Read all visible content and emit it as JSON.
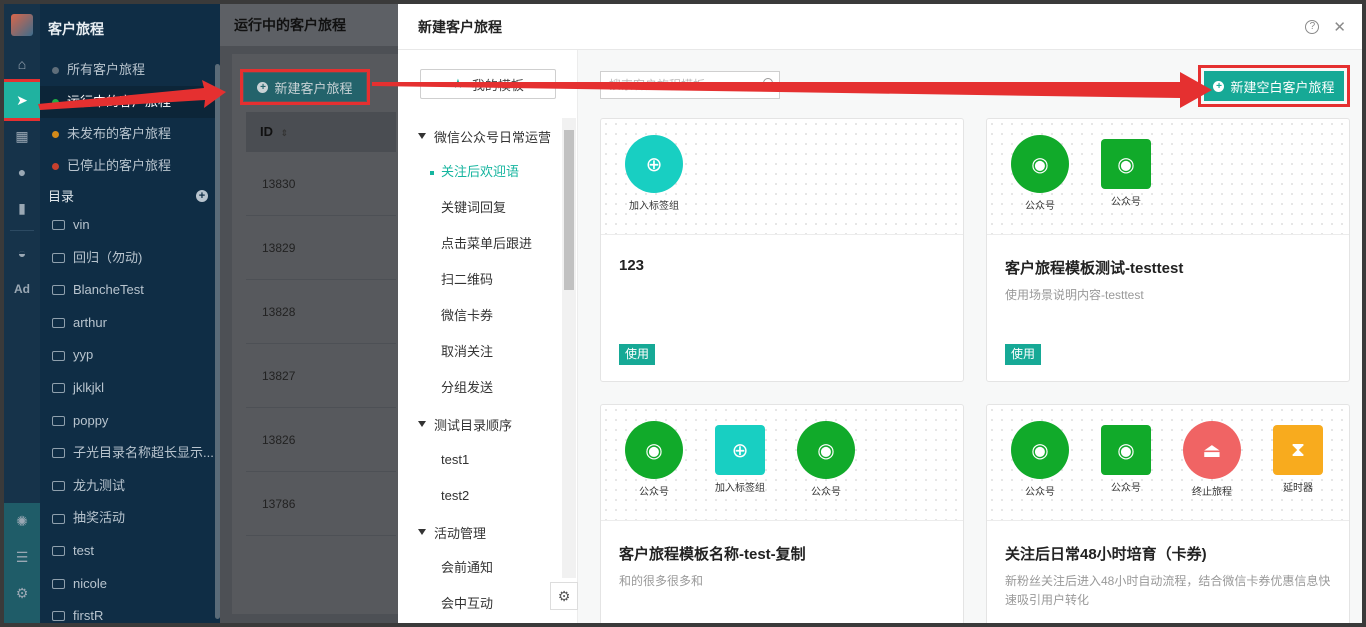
{
  "rail": {
    "items": [
      "home-icon",
      "journey-icon",
      "grid-icon",
      "user-icon",
      "chart-icon",
      "wechat-icon",
      "ad-icon"
    ],
    "ad_label": "Ad"
  },
  "nav": {
    "title": "客户旅程",
    "status_items": [
      {
        "label": "所有客户旅程",
        "color": "#5f6e7a"
      },
      {
        "label": "运行中的客户旅程",
        "color": "#1fae45"
      },
      {
        "label": "未发布的客户旅程",
        "color": "#d38a1a"
      },
      {
        "label": "已停止的客户旅程",
        "color": "#c7402e"
      }
    ],
    "catalog_label": "目录",
    "catalog_add": "+",
    "folders": [
      "vin",
      "回归（勿动)",
      "BlancheTest",
      "arthur",
      "yyp",
      "jklkjkl",
      "poppy",
      "子光目录名称超长显示...",
      "龙九测试",
      "抽奖活动",
      "test",
      "nicole",
      "firstR"
    ]
  },
  "main": {
    "title": "运行中的客户旅程",
    "new_button": "新建客户旅程",
    "new_button_plus": "+",
    "col_id": "ID",
    "rows": [
      "13830",
      "13829",
      "13828",
      "13827",
      "13826",
      "13786"
    ]
  },
  "modal": {
    "title": "新建客户旅程",
    "help": "?",
    "close": "✕",
    "my_templates": "我的模板",
    "search_placeholder": "搜索客户旅程模板",
    "blank_button": "新建空白客户旅程",
    "blank_button_plus": "+",
    "tree": [
      {
        "group": "微信公众号日常运营",
        "items": [
          "关注后欢迎语",
          "关键词回复",
          "点击菜单后跟进",
          "扫二维码",
          "微信卡券",
          "取消关注",
          "分组发送"
        ]
      },
      {
        "group": "测试目录顺序",
        "items": [
          "test1",
          "test2"
        ]
      },
      {
        "group": "活动管理",
        "items": [
          "会前通知",
          "会中互动"
        ]
      }
    ],
    "active_item": "关注后欢迎语",
    "use_label": "使用",
    "templates": [
      {
        "name": "123",
        "desc": "",
        "nodes": [
          {
            "label": "加入标签组",
            "icon": "user-plus-icon",
            "color": "#18cfc2"
          }
        ],
        "has_use": true
      },
      {
        "name": "客户旅程模板测试-testtest",
        "desc": "使用场景说明内容-testtest",
        "nodes": [
          {
            "label": "公众号",
            "icon": "wechat-icon",
            "color": "#11aa2a"
          },
          {
            "label": "公众号",
            "icon": "wechat-icon",
            "color": "#11aa2a"
          }
        ],
        "has_use": true
      },
      {
        "name": "客户旅程模板名称-test-复制",
        "desc": "和的很多很多和",
        "nodes": [
          {
            "label": "公众号",
            "icon": "wechat-icon",
            "color": "#11aa2a"
          },
          {
            "label": "加入标签组",
            "icon": "user-plus-icon",
            "color": "#18cfc2"
          },
          {
            "label": "公众号",
            "icon": "wechat-icon",
            "color": "#11aa2a"
          }
        ],
        "has_use": false
      },
      {
        "name": "关注后日常48小时培育（卡券)",
        "desc": "新粉丝关注后进入48小时自动流程，结合微信卡券优惠信息快速吸引用户转化",
        "nodes": [
          {
            "label": "公众号",
            "icon": "wechat-icon",
            "color": "#11aa2a"
          },
          {
            "label": "公众号",
            "icon": "wechat-icon",
            "color": "#11aa2a"
          },
          {
            "label": "终止旅程",
            "icon": "stop-icon",
            "color": "#f06464"
          },
          {
            "label": "延时器",
            "icon": "hourglass-icon",
            "color": "#f8ab1e"
          }
        ],
        "has_use": false
      }
    ]
  }
}
